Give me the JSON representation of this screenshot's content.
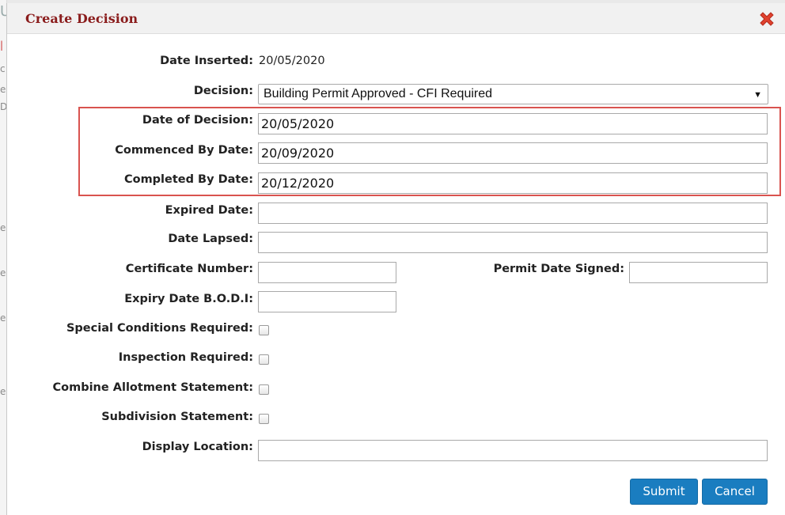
{
  "dialog": {
    "title": "Create Decision"
  },
  "fields": {
    "date_inserted": {
      "label": "Date Inserted:",
      "value": "20/05/2020"
    },
    "decision": {
      "label": "Decision:",
      "value": "Building Permit Approved - CFI Required"
    },
    "date_of_decision": {
      "label": "Date of Decision:",
      "value": "20/05/2020"
    },
    "commenced_by_date": {
      "label": "Commenced By Date:",
      "value": "20/09/2020"
    },
    "completed_by_date": {
      "label": "Completed By Date:",
      "value": "20/12/2020"
    },
    "expired_date": {
      "label": "Expired Date:",
      "value": ""
    },
    "date_lapsed": {
      "label": "Date Lapsed:",
      "value": ""
    },
    "certificate_number": {
      "label": "Certificate Number:",
      "value": ""
    },
    "permit_date_signed": {
      "label": "Permit Date Signed:",
      "value": ""
    },
    "expiry_date_bodi": {
      "label": "Expiry Date B.O.D.I:",
      "value": ""
    },
    "special_conditions_required": {
      "label": "Special Conditions Required:",
      "checked": false
    },
    "inspection_required": {
      "label": "Inspection Required:",
      "checked": false
    },
    "combine_allotment_statement": {
      "label": "Combine Allotment Statement:",
      "checked": false
    },
    "subdivision_statement": {
      "label": "Subdivision Statement:",
      "checked": false
    },
    "display_location": {
      "label": "Display Location:",
      "value": ""
    }
  },
  "buttons": {
    "submit": "Submit",
    "cancel": "Cancel"
  },
  "colors": {
    "title": "#8a1c1c",
    "button": "#1a7dc0",
    "highlight": "#d9534f",
    "close_icon": "#e0412e"
  },
  "icons": {
    "close": "close-icon",
    "dropdown": "chevron-down-icon"
  },
  "background_fragments": [
    "U",
    "|",
    "c",
    "e",
    "D",
    "e",
    "e",
    "e",
    "e"
  ]
}
